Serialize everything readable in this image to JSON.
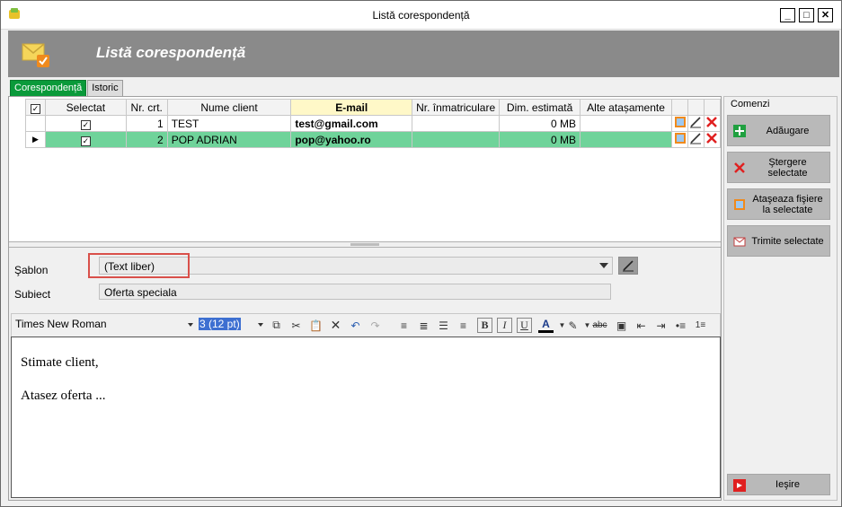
{
  "window": {
    "title": "Listă corespondență",
    "minimize": "_",
    "maximize": "□",
    "close": "✕"
  },
  "banner": {
    "title": "Listă corespondență"
  },
  "tabs": [
    {
      "label": "Corespondență",
      "active": true
    },
    {
      "label": "Istoric",
      "active": false
    }
  ],
  "grid": {
    "columns": [
      "Selectat",
      "Nr. crt.",
      "Nume client",
      "E-mail",
      "Nr. înmatriculare",
      "Dim. estimată",
      "Alte atașamente"
    ],
    "rows": [
      {
        "selected_mark": "✓",
        "nr": "1",
        "name": "TEST",
        "email": "test@gmail.com",
        "plate": "",
        "size": "0 MB",
        "attachments": ""
      },
      {
        "selected_mark": "✓",
        "nr": "2",
        "name": "POP ADRIAN",
        "email": "pop@yahoo.ro",
        "plate": "",
        "size": "0 MB",
        "attachments": ""
      }
    ],
    "header_check": "✓",
    "current_row_indicator": "▶"
  },
  "form": {
    "template_label": "Şablon",
    "template_value": "(Text liber)",
    "subject_label": "Subiect",
    "subject_value": "Oferta speciala"
  },
  "editor": {
    "font": "Times New Roman",
    "size": "3 (12 pt)",
    "lines": [
      "Stimate client,",
      "Atasez oferta ..."
    ]
  },
  "commands": {
    "group_title": "Comenzi",
    "add": "Adăugare",
    "delete": "Ştergere selectate",
    "attach": "Ataşeaza fişiere la selectate",
    "send": "Trimite selectate",
    "exit": "Ieşire"
  },
  "colors": {
    "tab_active": "#0a9a3a",
    "selected_row": "#6fd39a",
    "email_header": "#fff8c8",
    "highlight": "#d9504a"
  }
}
